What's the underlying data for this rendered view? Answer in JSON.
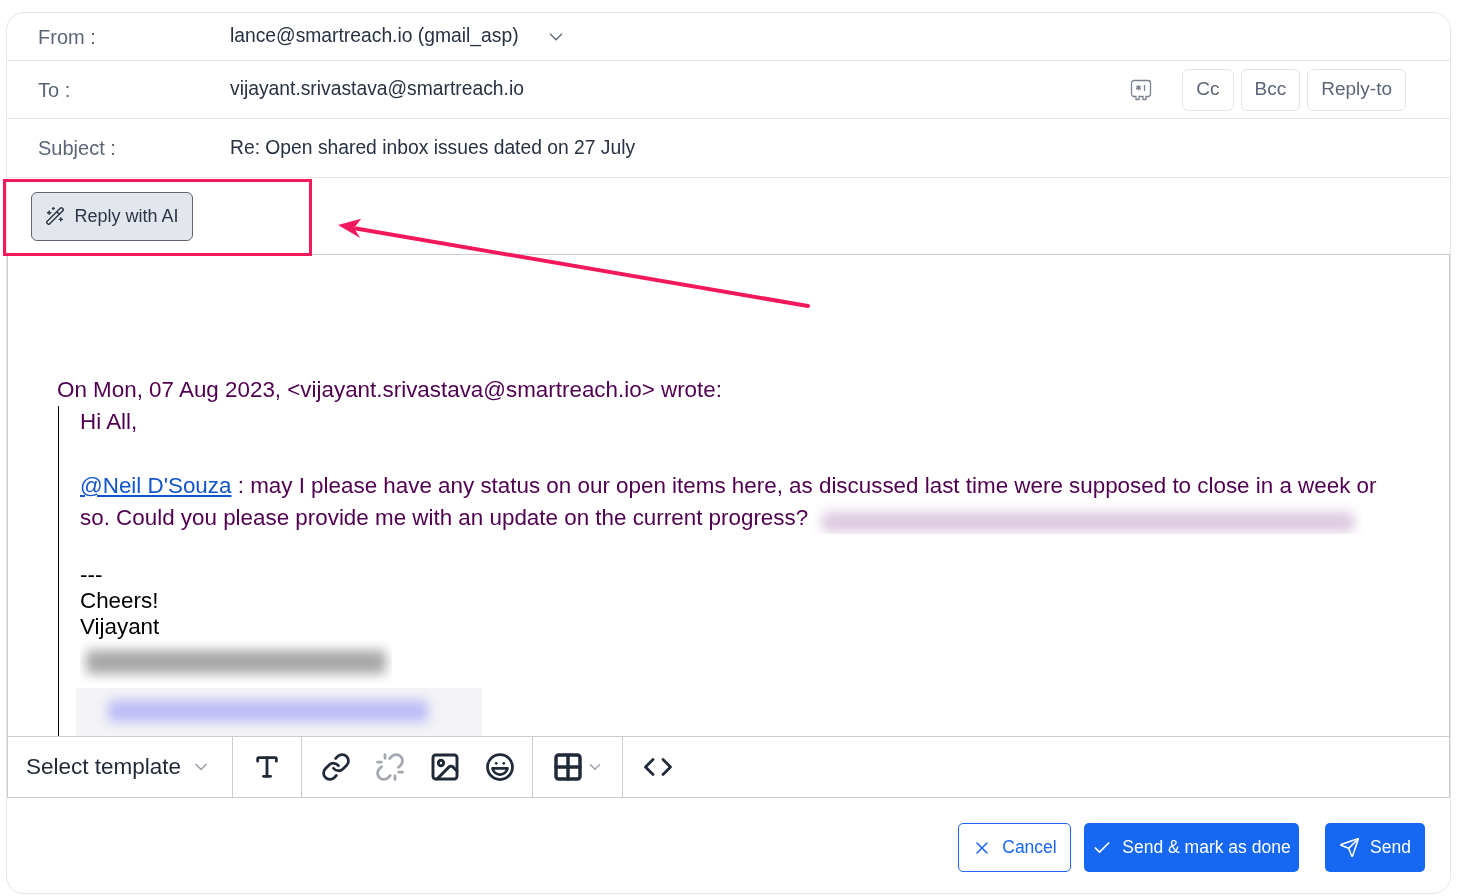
{
  "fields": [
    {
      "kind": "from",
      "label": "From :",
      "value": "lance@smartreach.io (gmail_asp)"
    },
    {
      "kind": "to",
      "label": "To :",
      "value": "vijayant.srivastava@smartreach.io",
      "buttons": [
        "Cc",
        "Bcc",
        "Reply-to"
      ]
    },
    {
      "kind": "subject",
      "label": "Subject :",
      "value": "Re: Open shared inbox issues dated on 27 July"
    }
  ],
  "ai_button": {
    "label": "Reply with AI"
  },
  "quoted_message": {
    "attribution": "On Mon, 07 Aug 2023, <vijayant.srivastava@smartreach.io> wrote:",
    "greeting": "Hi All,",
    "mention": "@Neil D'Souza",
    "body": ": may I please have any status on our open items here, as discussed last time were supposed to close in a week or so. Could you please provide me with an update on the current progress?",
    "signature": [
      "---",
      "Cheers!",
      "Vijayant"
    ]
  },
  "toolbar": {
    "template_select": {
      "placeholder": "Select template"
    },
    "unlink_disabled": true
  },
  "actions": [
    {
      "kind": "cancel",
      "label": "Cancel"
    },
    {
      "kind": "done",
      "label": "Send & mark as done"
    },
    {
      "kind": "send",
      "label": "Send"
    }
  ]
}
